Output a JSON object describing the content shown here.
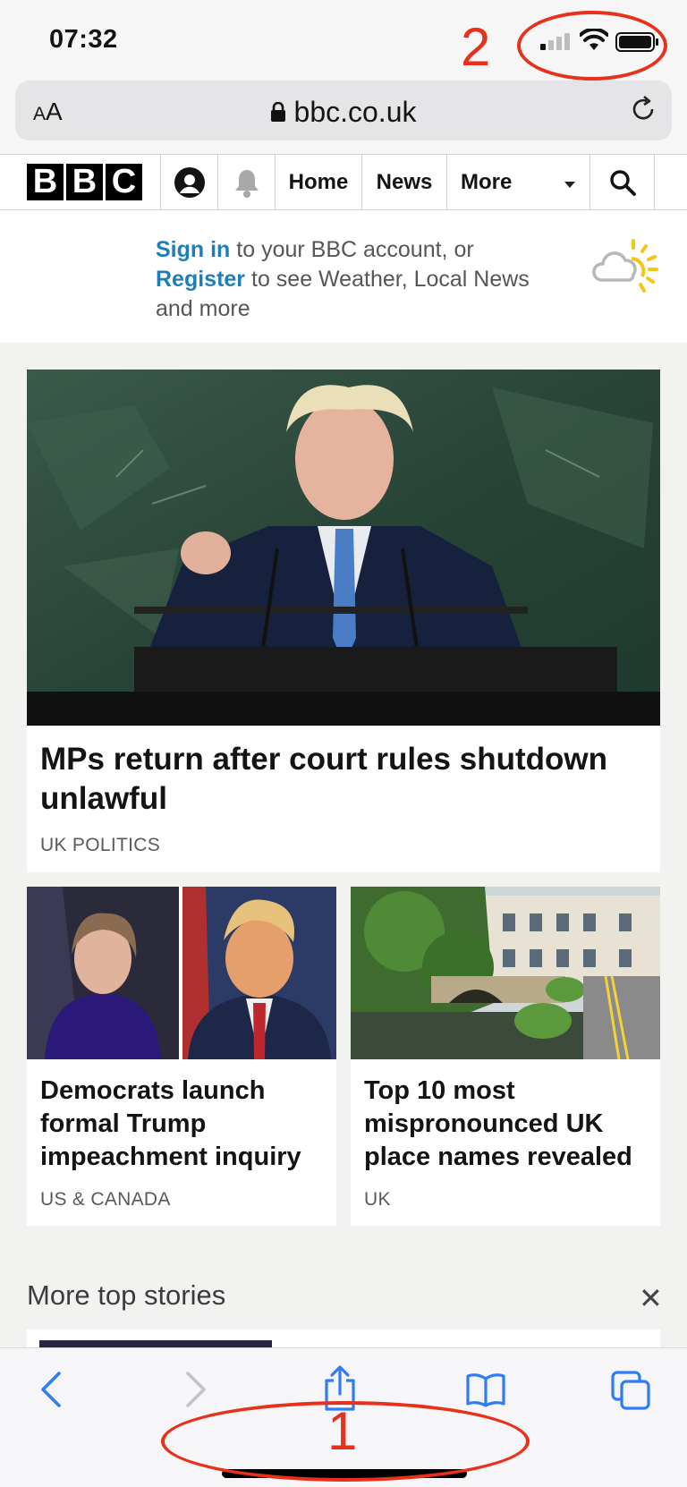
{
  "status_bar": {
    "time": "07:32"
  },
  "browser": {
    "text_size_label_small": "A",
    "text_size_label_large": "A",
    "url": "bbc.co.uk"
  },
  "bbc_nav": {
    "logo_letters": [
      "B",
      "B",
      "C"
    ],
    "home": "Home",
    "news": "News",
    "more": "More"
  },
  "promo": {
    "sign_in": "Sign in",
    "text1": " to your BBC account, or ",
    "register": "Register",
    "text2": " to see Weather, Local News and more"
  },
  "stories": {
    "top": {
      "headline": "MPs return after court rules shutdown unlawful",
      "section": "UK POLITICS"
    },
    "left": {
      "headline": "Democrats launch formal Trump impeachment inquiry",
      "section": "US & CANADA"
    },
    "right": {
      "headline": "Top 10 most mispronounced UK place names revealed",
      "section": "UK"
    }
  },
  "more_top_stories": {
    "title": "More top stories",
    "close": "✕"
  },
  "annotations": {
    "label1": "1",
    "label2": "2",
    "color": "#e8301b"
  },
  "colors": {
    "link": "#1f7eb8",
    "bbc_black": "#000000"
  }
}
